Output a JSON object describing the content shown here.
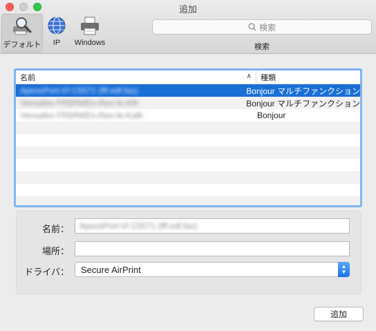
{
  "window": {
    "title": "追加"
  },
  "toolbar": {
    "items": [
      {
        "label": "デフォルト",
        "icon": "default-printer-search-icon",
        "selected": true
      },
      {
        "label": "IP",
        "icon": "globe-icon",
        "selected": false
      },
      {
        "label": "Windows",
        "icon": "printer-icon",
        "selected": false
      }
    ],
    "search": {
      "placeholder": "検索",
      "caption": "検索"
    }
  },
  "table": {
    "columns": {
      "name": "名前",
      "kind": "種類"
    },
    "rows": [
      {
        "name": "ApeosPort-VI C5571 (fff.edf.fax)",
        "kind": "Bonjour マルチファンクション",
        "selected": true
      },
      {
        "name": "Vensafes FR5RWEn-Ren-fe-Kfh",
        "kind": "Bonjour マルチファンクション",
        "selected": false
      },
      {
        "name": "Vensafes FR5RWEn-Ren-fe-Kafk",
        "kind": "Bonjour",
        "selected": false
      }
    ],
    "empty_rows": 7,
    "selection_color": "#1a6fd6"
  },
  "form": {
    "name_label": "名前：",
    "name_value": "ApeosPort-VI C5571 (fff.edf.fax)",
    "location_label": "場所：",
    "location_value": "",
    "driver_label": "ドライバ：",
    "driver_value": "Secure AirPrint"
  },
  "buttons": {
    "add": "追加"
  },
  "colors": {
    "accent": "#1a6fd6",
    "table_focus_ring": "#80b3f0"
  }
}
